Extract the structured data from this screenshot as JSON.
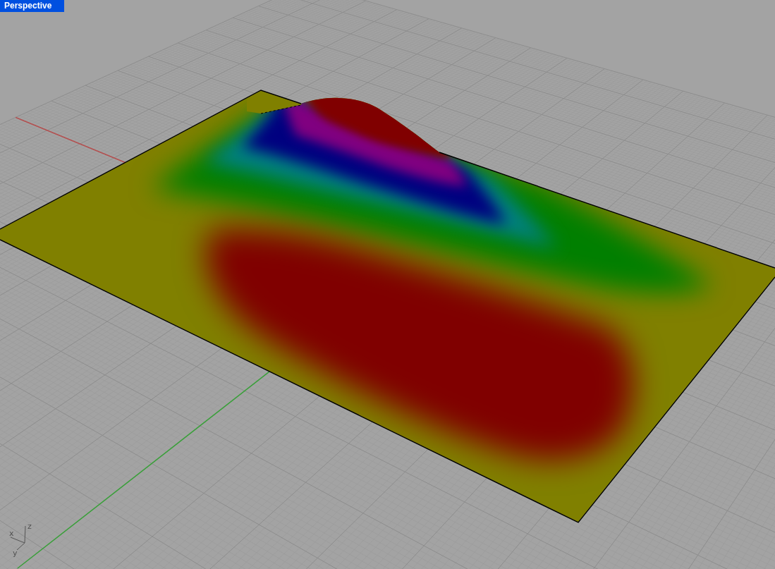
{
  "viewport": {
    "title": "Perspective",
    "active": true
  },
  "axes_indicator": {
    "x_label": "x",
    "y_label": "y",
    "z_label": "z"
  }
}
